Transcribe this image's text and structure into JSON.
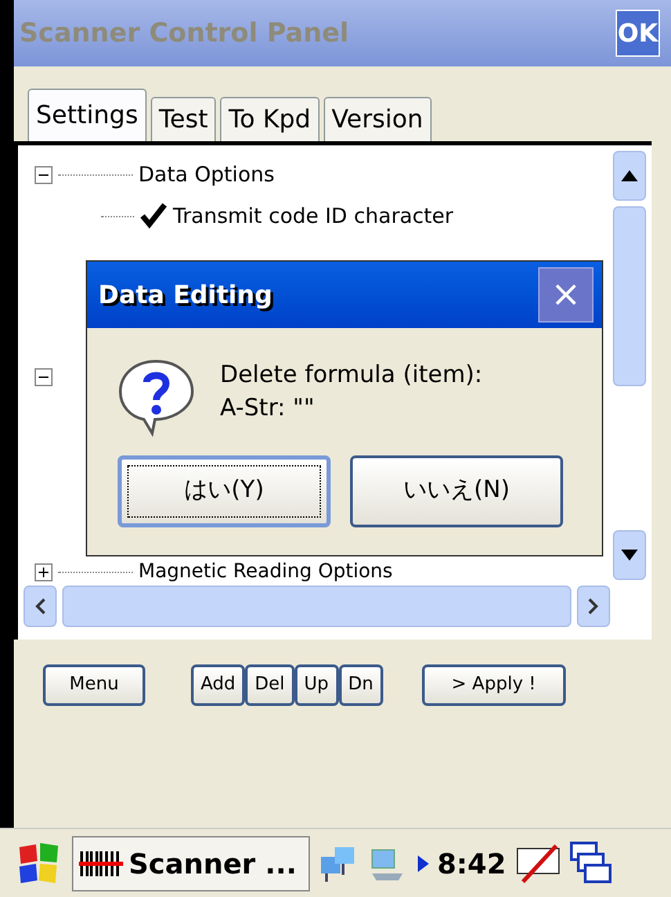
{
  "window": {
    "title": "Scanner Control Panel",
    "ok_button": "OK"
  },
  "tabs": [
    {
      "label": "Settings",
      "selected": true
    },
    {
      "label": "Test",
      "selected": false
    },
    {
      "label": "To Kpd",
      "selected": false
    },
    {
      "label": "Version",
      "selected": false
    }
  ],
  "tree": {
    "items": [
      {
        "label": "Data Options",
        "expanded": true,
        "children": [
          {
            "label": "Transmit code ID character",
            "checked": true
          }
        ]
      },
      {
        "label": "Magnetic Reading Options",
        "expanded": false
      }
    ]
  },
  "dialog": {
    "title": "Data Editing",
    "close": "×",
    "message": "Delete formula (item):\nA-Str: \"\"",
    "buttons": [
      {
        "label": "はい(Y)",
        "focused": true
      },
      {
        "label": "いいえ(N)",
        "focused": false
      }
    ]
  },
  "toolbar": {
    "menu": "Menu",
    "edit_buttons": [
      "Add",
      "Del",
      "Up",
      "Dn"
    ],
    "apply": "> Apply !"
  },
  "taskbar": {
    "task": "Scanner ...",
    "time": "8:42"
  }
}
